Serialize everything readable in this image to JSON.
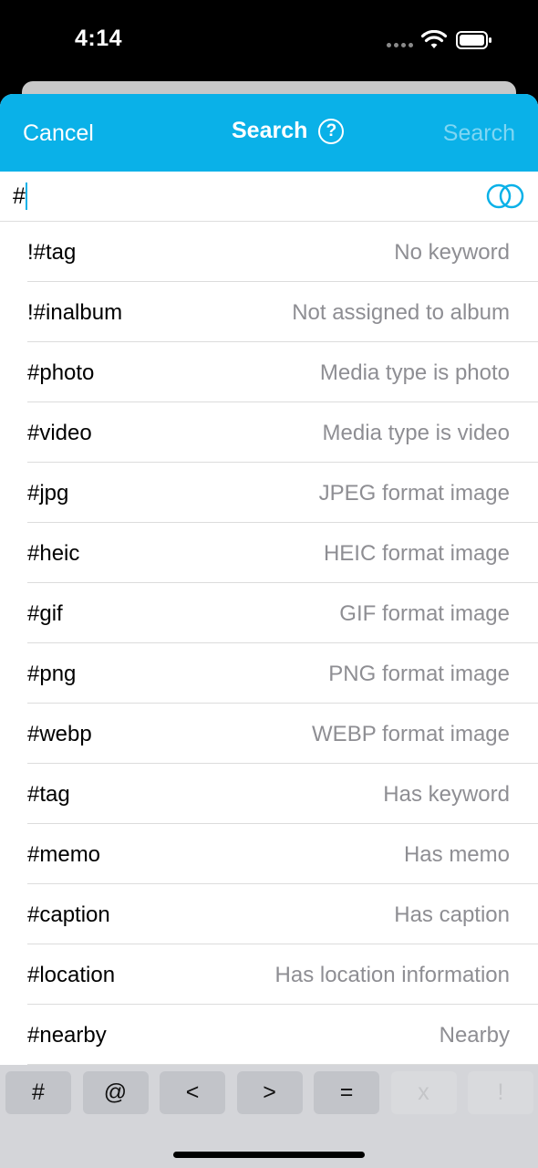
{
  "status": {
    "time": "4:14"
  },
  "nav": {
    "cancel": "Cancel",
    "title": "Search",
    "help_glyph": "?",
    "search": "Search",
    "accent_color": "#0ab1e8"
  },
  "search_field": {
    "value": "#",
    "match_icon": "overlapping-circles-icon"
  },
  "suggestions": [
    {
      "key": "!#tag",
      "desc": "No keyword"
    },
    {
      "key": "!#inalbum",
      "desc": "Not assigned to album"
    },
    {
      "key": "#photo",
      "desc": "Media type is photo"
    },
    {
      "key": "#video",
      "desc": "Media type is video"
    },
    {
      "key": "#jpg",
      "desc": "JPEG format image"
    },
    {
      "key": "#heic",
      "desc": "HEIC format image"
    },
    {
      "key": "#gif",
      "desc": "GIF format image"
    },
    {
      "key": "#png",
      "desc": "PNG format image"
    },
    {
      "key": "#webp",
      "desc": "WEBP format image"
    },
    {
      "key": "#tag",
      "desc": "Has keyword"
    },
    {
      "key": "#memo",
      "desc": "Has memo"
    },
    {
      "key": "#caption",
      "desc": "Has caption"
    },
    {
      "key": "#location",
      "desc": "Has location information"
    },
    {
      "key": "#nearby",
      "desc": "Nearby"
    }
  ],
  "keyboard_keys": [
    {
      "label": "#",
      "enabled": true
    },
    {
      "label": "@",
      "enabled": true
    },
    {
      "label": "<",
      "enabled": true
    },
    {
      "label": ">",
      "enabled": true
    },
    {
      "label": "=",
      "enabled": true
    },
    {
      "label": "x",
      "enabled": false
    },
    {
      "label": "!",
      "enabled": false
    }
  ]
}
